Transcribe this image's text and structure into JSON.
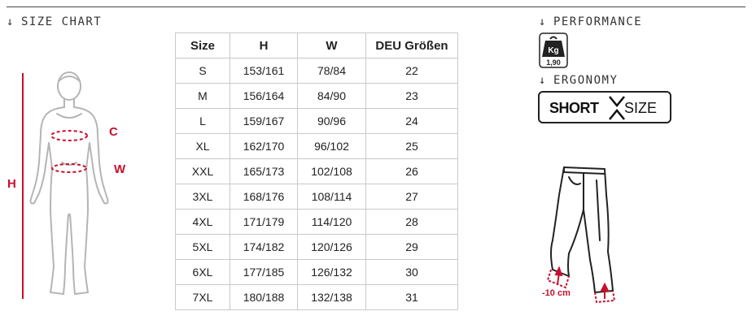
{
  "size_chart": {
    "heading": "SIZE CHART",
    "arrow": "↓",
    "dimension_labels": {
      "c": "C",
      "w": "W",
      "h": "H"
    },
    "columns": [
      "Size",
      "H",
      "W",
      "DEU Größen"
    ],
    "rows": [
      [
        "S",
        "153/161",
        "78/84",
        "22"
      ],
      [
        "M",
        "156/164",
        "84/90",
        "23"
      ],
      [
        "L",
        "159/167",
        "90/96",
        "24"
      ],
      [
        "XL",
        "162/170",
        "96/102",
        "25"
      ],
      [
        "XXL",
        "165/173",
        "102/108",
        "26"
      ],
      [
        "3XL",
        "168/176",
        "108/114",
        "27"
      ],
      [
        "4XL",
        "171/179",
        "114/120",
        "28"
      ],
      [
        "5XL",
        "174/182",
        "120/126",
        "29"
      ],
      [
        "6XL",
        "177/185",
        "126/132",
        "30"
      ],
      [
        "7XL",
        "180/188",
        "132/138",
        "31"
      ]
    ]
  },
  "performance": {
    "heading": "PERFORMANCE",
    "arrow": "↓",
    "weight_icon": "weight-kg-icon",
    "weight_unit": "Kg",
    "weight_value": "1,90"
  },
  "ergonomy": {
    "heading": "ERGONOMY",
    "arrow": "↓",
    "badge_bold": "SHORT",
    "badge_light": "SIZE",
    "badge_icon": "short-size-x-icon"
  },
  "trousers": {
    "icon": "trousers-outline-icon",
    "shortening_label": "-10 cm"
  },
  "colors": {
    "accent": "#c8102e",
    "outline": "#222222",
    "figure": "#b5b5b5",
    "grid": "#c9c9c9"
  }
}
